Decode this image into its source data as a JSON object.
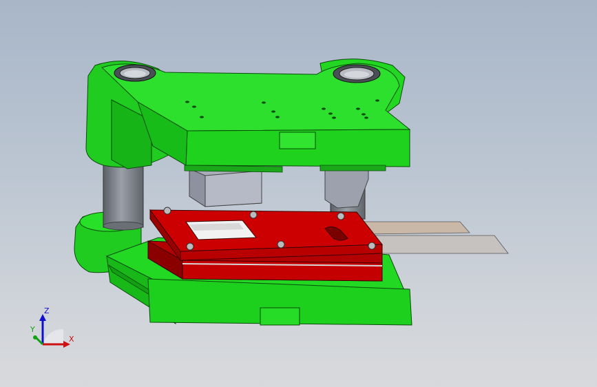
{
  "viewport": {
    "background_top": "#a8b6c8",
    "background_bottom": "#d8d9dc"
  },
  "model": {
    "die_set_color": "#22dd22",
    "plate_color": "#c80000",
    "guide_post_color": "#8a8f96",
    "punch_color": "#a8acb8",
    "strip_color": "#c8b8a8"
  },
  "triad": {
    "z_label": "Z",
    "y_label": "Y",
    "x_label": "X",
    "z_color": "#1010cc",
    "y_color": "#10a010",
    "x_color": "#cc1010"
  }
}
